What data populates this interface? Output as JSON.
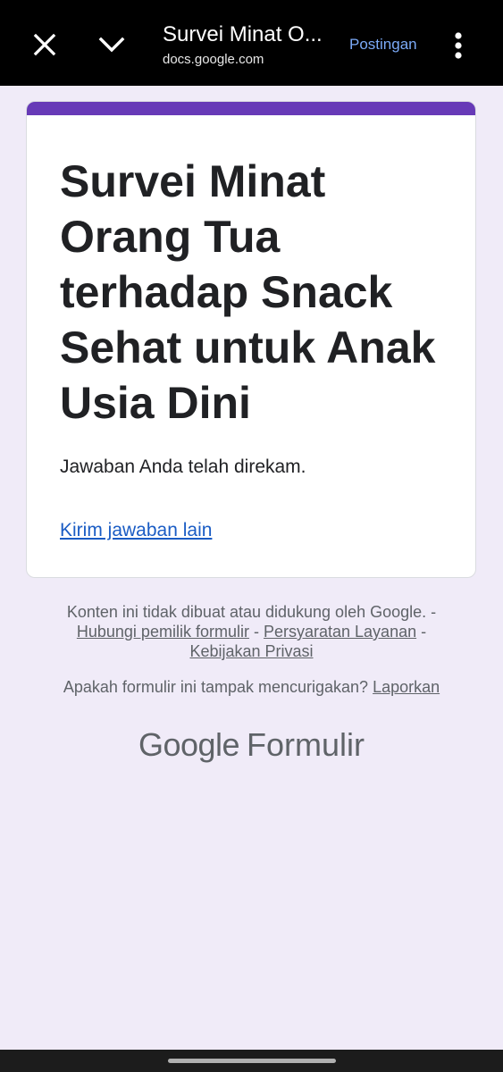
{
  "toolbar": {
    "title": "Survei Minat O...",
    "url": "docs.google.com",
    "post_label": "Postingan",
    "icons": {
      "close": "close-icon",
      "collapse": "chevron-down-icon",
      "more": "more-vert-icon"
    }
  },
  "form": {
    "title": "Survei Minat Orang Tua terhadap Snack Sehat untuk Anak Usia Dini",
    "confirmation": "Jawaban Anda telah direkam.",
    "another_response_link": "Kirim jawaban lain"
  },
  "footer": {
    "disclaimer": "Konten ini tidak dibuat atau didukung oleh Google.",
    "sep": "-",
    "contact_owner": "Hubungi pemilik formulir",
    "terms": "Persyaratan Layanan",
    "privacy": "Kebijakan Privasi",
    "suspicious": "Apakah formulir ini tampak mencurigakan?",
    "report": "Laporkan",
    "brand_google": "Google",
    "brand_product": "Formulir"
  },
  "colors": {
    "accent": "#673ab7",
    "background": "#f0ebf8",
    "link": "#1a5cc4",
    "toolbar": "#000000"
  }
}
